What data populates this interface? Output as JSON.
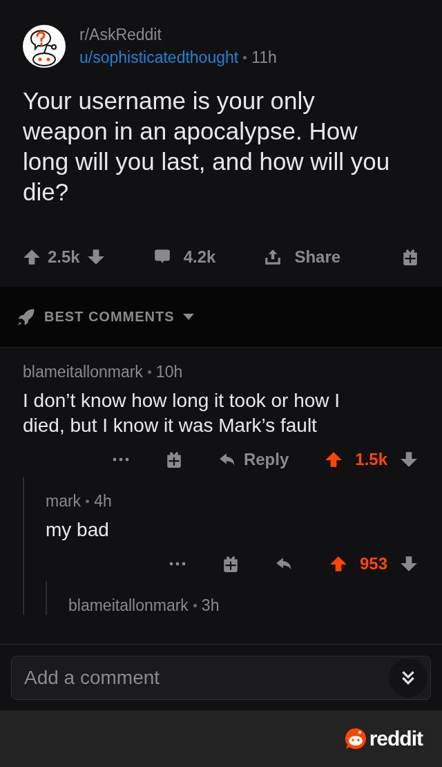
{
  "post": {
    "subreddit": "r/AskReddit",
    "author": "u/sophisticatedthought",
    "time": "11h",
    "title": "Your username is your only weapon in an apocalypse. How long will you last, and how will you die?",
    "score": "2.5k",
    "upvoted": false,
    "comments": "4.2k",
    "share": "Share"
  },
  "sort": {
    "label": "BEST COMMENTS"
  },
  "comments": [
    {
      "author": "blameitallonmark",
      "time": "10h",
      "body": "I don’t know how long it took or how I died, but I know it was Mark’s fault",
      "reply_label": "Reply",
      "score": "1.5k",
      "upvoted": true,
      "children": [
        {
          "author": "mark",
          "time": "4h",
          "body": "my bad",
          "score": "953",
          "upvoted": true,
          "children": [
            {
              "author": "blameitallonmark",
              "time": "3h"
            }
          ]
        }
      ]
    }
  ],
  "composer": {
    "placeholder": "Add a comment"
  },
  "footer": {
    "brand": "reddit"
  }
}
